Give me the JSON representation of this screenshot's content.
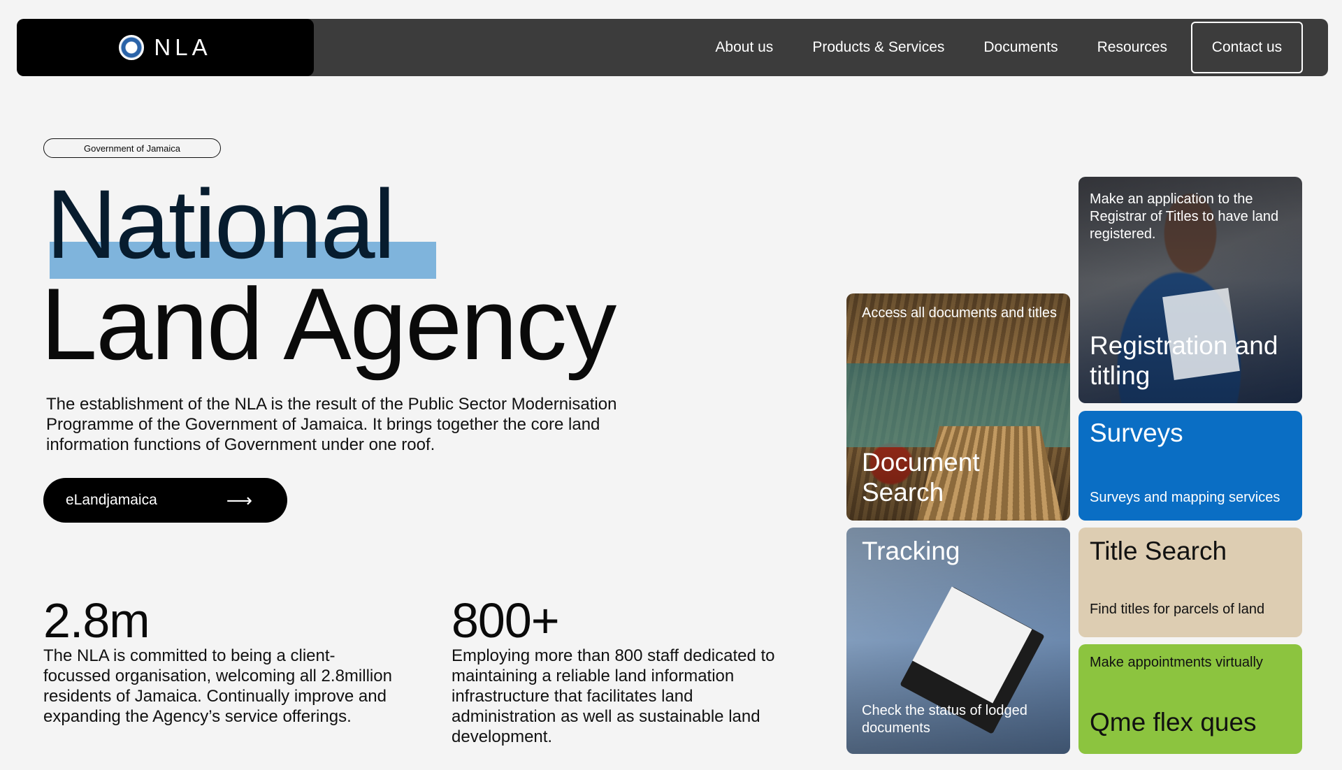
{
  "nav": {
    "brand": "NLA",
    "links": [
      "About us",
      "Products & Services",
      "Documents",
      "Resources"
    ],
    "contact": "Contact us"
  },
  "hero": {
    "badge": "Government of Jamaica",
    "title_line1": "National",
    "title_line2": "Land Agency",
    "highlight_color": "#7fb4dc",
    "description": "The establishment of the NLA is the result of the Public Sector Modernisation Programme of the Government of Jamaica. It brings together the core land information functions of Government under one roof.",
    "cta_label": "eLandjamaica",
    "cta_arrow": "⟶"
  },
  "stats": [
    {
      "number": "2.8m",
      "description": "The NLA is committed to being a client-focussed organisation, welcoming all 2.8million residents of Jamaica. Continually improve and expanding the Agency’s service offerings."
    },
    {
      "number": "800+",
      "description": "Employing more than 800 staff dedicated to maintaining a reliable land information infrastructure that facilitates land administration as well as sustainable land development."
    }
  ],
  "cards": {
    "registration": {
      "subtitle": "Make an application to the Registrar of Titles to have land registered.",
      "title": "Registration and titling"
    },
    "document": {
      "subtitle": "Access all documents and titles",
      "title": "Document Search"
    },
    "surveys": {
      "title": "Surveys",
      "subtitle": "Surveys and mapping services",
      "color": "#0a6ec4"
    },
    "tracking": {
      "title": "Tracking",
      "subtitle": "Check the status of lodged documents"
    },
    "title_search": {
      "title": "Title Search",
      "subtitle": "Find titles for parcels of land",
      "color": "#ddcdb2"
    },
    "qme": {
      "subtitle": "Make appointments virtually",
      "title": "Qme flex ques",
      "color": "#8cc43f"
    }
  }
}
